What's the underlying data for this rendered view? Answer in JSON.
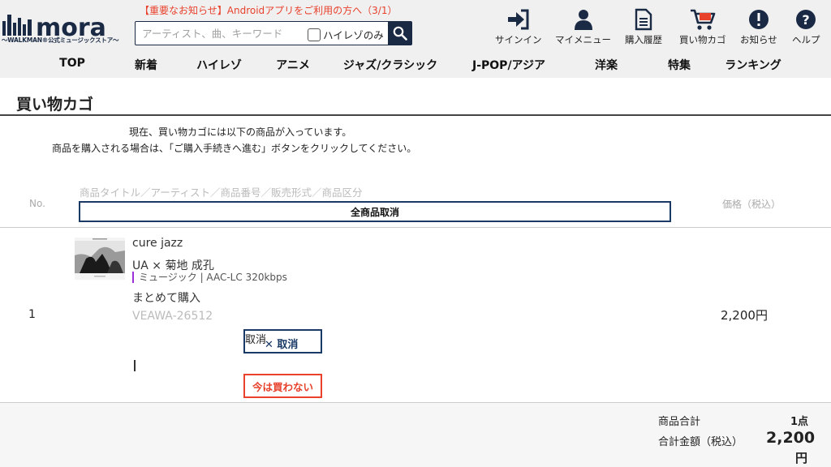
{
  "header": {
    "logo_text": "mora",
    "logo_subtitle": "～WALKMAN®公式ミュージックストア～",
    "notice": "【重要なお知らせ】Androidアプリをご利用の方へ（3/1）",
    "search": {
      "placeholder": "アーティスト、曲、キーワード",
      "hires_label": "ハイレゾのみ"
    },
    "utility_nav": [
      {
        "label": "サインイン",
        "icon": "sign-in-icon"
      },
      {
        "label": "マイメニュー",
        "icon": "user-icon"
      },
      {
        "label": "購入履歴",
        "icon": "document-icon"
      },
      {
        "label": "買い物カゴ",
        "icon": "cart-icon"
      },
      {
        "label": "お知らせ",
        "icon": "exclamation-icon"
      },
      {
        "label": "ヘルプ",
        "icon": "question-icon"
      }
    ],
    "main_nav": [
      "TOP",
      "新着",
      "ハイレゾ",
      "アニメ",
      "ジャズ/クラシック",
      "J-POP/アジア",
      "洋楽",
      "特集",
      "ランキング"
    ]
  },
  "page": {
    "title": "買い物カゴ",
    "intro_line1": "現在、買い物カゴには以下の商品が入っています。",
    "intro_line2": "商品を購入される場合は、「ご購入手続きへ進む」ボタンをクリックしてください。"
  },
  "table": {
    "col_no": "No.",
    "col_item": "商品タイトル／アーティスト／商品番号／販売形式／商品区分",
    "col_price": "価格（税込）",
    "cancel_all_label": "全商品取消",
    "rows": [
      {
        "no": "1",
        "title": "cure jazz",
        "artist": "UA × 菊地 成孔",
        "format": "ミュージック | AAC-LC 320kbps",
        "purchase_type": "まとめて購入",
        "code": "VEAWA-26512",
        "cancel_overlay": "取消",
        "cancel_label": "✕ 取消",
        "later_label": "今は買わない",
        "price": "2,200円"
      }
    ]
  },
  "summary": {
    "count_label": "商品合計",
    "count_value": "1点",
    "total_label": "合計金額（税込）",
    "total_value": "2,200",
    "total_unit": "円"
  },
  "colors": {
    "navy": "#1a2a44",
    "accent_red": "#e8412c",
    "format_bar": "#9b30d9"
  }
}
